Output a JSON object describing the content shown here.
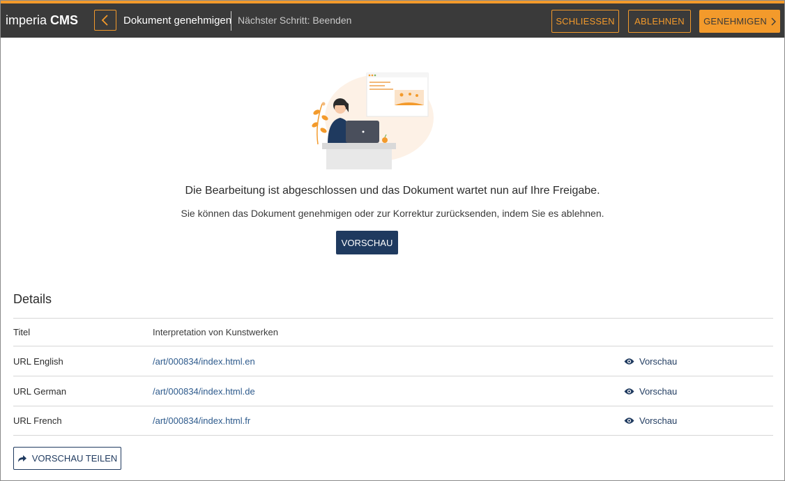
{
  "header": {
    "logo_light": "imperia ",
    "logo_bold": "CMS",
    "title": "Dokument genehmigen",
    "next_step": "Nächster Schritt: Beenden",
    "close_label": "SCHLIESSEN",
    "reject_label": "ABLEHNEN",
    "approve_label": "GENEHMIGEN"
  },
  "main": {
    "message": "Die Bearbeitung ist abgeschlossen und das Dokument wartet nun auf Ihre Freigabe.",
    "submessage": "Sie können das Dokument genehmigen oder zur Korrektur zurücksenden, indem Sie es ablehnen.",
    "preview_label": "VORSCHAU"
  },
  "details": {
    "title": "Details",
    "rows": [
      {
        "label": "Titel",
        "value": "Interpretation von Kunstwerken"
      },
      {
        "label": "URL English",
        "value": "/art/000834/index.html.en",
        "action": "Vorschau"
      },
      {
        "label": "URL German",
        "value": "/art/000834/index.html.de",
        "action": "Vorschau"
      },
      {
        "label": "URL French",
        "value": "/art/000834/index.html.fr",
        "action": "Vorschau"
      }
    ],
    "share_label": "VORSCHAU TEILEN"
  },
  "colors": {
    "accent": "#f39a2b",
    "header_bg": "#3a3a3a",
    "primary": "#1f3a5f"
  }
}
